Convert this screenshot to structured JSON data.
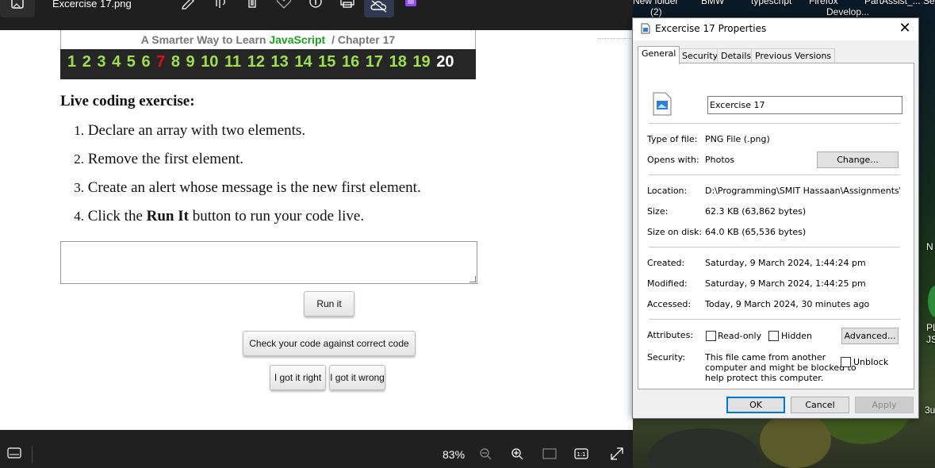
{
  "viewer": {
    "file_name": "Excercise 17.png",
    "zoom": "83%",
    "toolbar_icons": [
      "edit-image-icon",
      "visual-search-icon",
      "delete-icon",
      "favorite-icon",
      "info-icon",
      "print-icon",
      "onedrive-icon",
      "designer-icon",
      "more-icon"
    ],
    "more_label": "···"
  },
  "page": {
    "banner_prefix": "A Smarter Way to Learn ",
    "banner_js": "JavaScript",
    "banner_suffix": "/  Chapter 17",
    "chapters": [
      "1",
      "2",
      "3",
      "4",
      "5",
      "6",
      "7",
      "8",
      "9",
      "10",
      "11",
      "12",
      "13",
      "14",
      "15",
      "16",
      "17",
      "18",
      "19",
      "20"
    ],
    "current_chapter_index": 6,
    "exercise_title": "Live coding exercise:",
    "steps": [
      {
        "num": "1.",
        "text": "Declare an array with two elements."
      },
      {
        "num": "2.",
        "text": "Remove the first element."
      },
      {
        "num": "3.",
        "text": "Create an alert whose message is the new first element."
      },
      {
        "num": "4.",
        "text_before": "Click the ",
        "text_bold": "Run It",
        "text_after": " button to run your code live."
      }
    ],
    "run_button": "Run it",
    "check_button": "Check your code against correct code",
    "right_button": "I got it right",
    "wrong_button": "I got it wrong"
  },
  "desktop": {
    "items": [
      "New folder\n(2)",
      "BMW",
      "typescript",
      "Firefox\nDevelop...",
      "PartAssist_...",
      "Se"
    ],
    "edge_labels": [
      "N",
      "PL",
      "JS",
      "3u"
    ]
  },
  "properties": {
    "title": "Excercise 17 Properties",
    "close": "✕",
    "tabs": [
      "General",
      "Security",
      "Details",
      "Previous Versions"
    ],
    "file_name": "Excercise 17",
    "type_label": "Type of file:",
    "type_value": "PNG File (.png)",
    "opens_label": "Opens with:",
    "opens_value": "Photos",
    "change_button": "Change...",
    "location_label": "Location:",
    "location_value": "D:\\Programming\\SMIT Hassaan\\Assignments\\Exce",
    "size_label": "Size:",
    "size_value": "62.3 KB (63,862 bytes)",
    "disk_label": "Size on disk:",
    "disk_value": "64.0 KB (65,536 bytes)",
    "created_label": "Created:",
    "created_value": "Saturday, 9 March 2024, 1:44:24 pm",
    "modified_label": "Modified:",
    "modified_value": "Saturday, 9 March 2024, 1:44:25 pm",
    "accessed_label": "Accessed:",
    "accessed_value": "Today, 9 March 2024, 30 minutes ago",
    "attributes_label": "Attributes:",
    "readonly_label": "Read-only",
    "hidden_label": "Hidden",
    "advanced_button": "Advanced...",
    "security_label": "Security:",
    "security_text_1": "This file came from another",
    "security_text_2": "computer and might be blocked to",
    "security_text_3": "help protect this computer.",
    "unblock_label": "Unblock",
    "ok_button": "OK",
    "cancel_button": "Cancel",
    "apply_button": "Apply",
    "accent": "#0078d7"
  }
}
